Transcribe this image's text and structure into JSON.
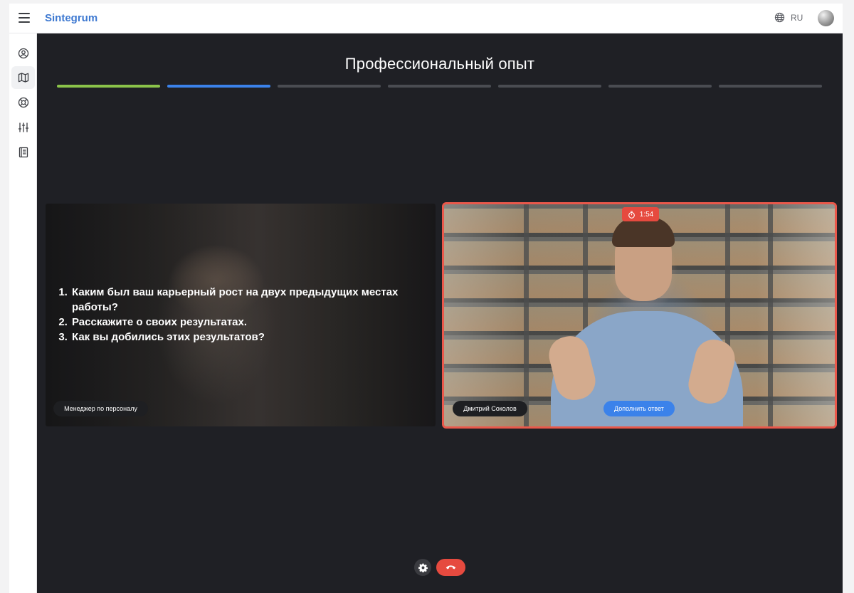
{
  "app": {
    "brand": "Sintegrum"
  },
  "header": {
    "menu_icon": "hamburger-icon",
    "language": "RU",
    "language_icon": "globe-icon",
    "avatar_icon": "avatar"
  },
  "sidebar": {
    "items": [
      {
        "icon": "user-circle-icon",
        "active": false
      },
      {
        "icon": "map-icon",
        "active": true
      },
      {
        "icon": "lifebuoy-icon",
        "active": false
      },
      {
        "icon": "sliders-icon",
        "active": false
      },
      {
        "icon": "book-icon",
        "active": false
      }
    ]
  },
  "main": {
    "title": "Профессиональный опыт",
    "progress": {
      "total_steps": 7,
      "completed_steps": 1,
      "current_step": 2,
      "colors": {
        "completed": "#8bc34a",
        "current": "#3b82ea",
        "pending": "#4a4c52"
      }
    },
    "left_tile": {
      "questions": [
        "Каким был ваш карьерный рост на двух предыдущих местах работы?",
        "Расскажите о своих результатах.",
        "Как вы добились этих результатов?"
      ],
      "speaker_label": "Менеджер по персоналу"
    },
    "right_tile": {
      "timer": "1:54",
      "timer_icon": "stopwatch-icon",
      "speaker_label": "Дмитрий Соколов",
      "action_button": "Дополнить ответ",
      "border_color": "#e9584b"
    }
  },
  "controls": {
    "settings_icon": "gear-icon",
    "hangup_icon": "phone-hangup-icon",
    "hangup_color": "#e64a3f"
  }
}
